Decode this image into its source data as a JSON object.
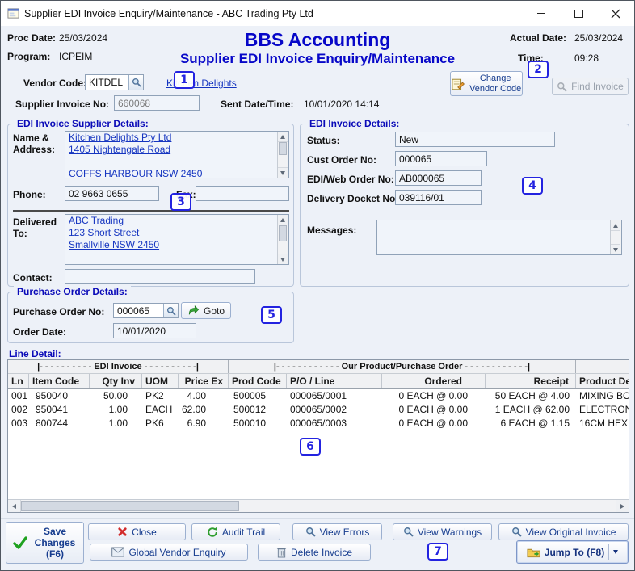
{
  "window": {
    "title": "Supplier EDI Invoice Enquiry/Maintenance - ABC Trading Pty Ltd"
  },
  "header": {
    "proc_date_label": "Proc Date:",
    "proc_date": "25/03/2024",
    "program_label": "Program:",
    "program": "ICPEIM",
    "app_title": "BBS Accounting",
    "screen_title": "Supplier EDI Invoice Enquiry/Maintenance",
    "actual_date_label": "Actual Date:",
    "actual_date": "25/03/2024",
    "time_label": "Time:",
    "time": "09:28"
  },
  "vendor": {
    "label": "Vendor Code:",
    "code": "KITDEL",
    "name_link": "Kitchen Delights",
    "change_button": "Change Vendor Code",
    "find_button": "Find Invoice"
  },
  "invoice": {
    "supplier_invoice_label": "Supplier Invoice No:",
    "supplier_invoice_no": "660068",
    "sent_label": "Sent Date/Time:",
    "sent_datetime": "10/01/2020 14:14"
  },
  "supplier_details": {
    "group_title": "EDI Invoice Supplier Details:",
    "name_address_label": "Name & Address:",
    "address_lines": [
      "Kitchen Delights Pty Ltd",
      "1405 Nightengale Road",
      "",
      "COFFS HARBOUR NSW 2450"
    ],
    "phone_label": "Phone:",
    "phone": "02 9663 0655",
    "fax_label": "Fax:",
    "fax": "",
    "delivered_label": "Delivered To:",
    "delivered_lines": [
      "ABC Trading",
      "123 Short Street",
      "Smallville NSW 2450"
    ],
    "contact_label": "Contact:",
    "contact": ""
  },
  "invoice_details": {
    "group_title": "EDI Invoice Details:",
    "status_label": "Status:",
    "status": "New",
    "cust_order_label": "Cust Order No:",
    "cust_order_no": "000065",
    "edi_web_order_label": "EDI/Web Order No:",
    "edi_web_order_no": "AB000065",
    "delivery_docket_label": "Delivery Docket No:",
    "delivery_docket_no": "039116/01",
    "messages_label": "Messages:",
    "messages": ""
  },
  "purchase_order": {
    "group_title": "Purchase Order Details:",
    "po_label": "Purchase Order No:",
    "po_no": "000065",
    "goto_button": "Goto",
    "order_date_label": "Order Date:",
    "order_date": "10/01/2020"
  },
  "line_detail": {
    "section_label": "Line Detail:",
    "band_edi": "|- - - - - - - - - -  EDI Invoice  - - - - - - - - - -|",
    "band_our": "|- - - - - - - - - - - -  Our Product/Purchase Order  - - - - - - - - - - - -|",
    "columns": [
      "Ln",
      "Item Code",
      "Qty Inv",
      "UOM",
      "Price Ex",
      "Prod Code",
      "P/O / Line",
      "Ordered",
      "Receipt",
      "Product De"
    ],
    "rows": [
      [
        "001",
        "950040",
        "50.00",
        "PK2",
        "4.00",
        "500005",
        "000065/0001",
        "0 EACH @ 0.00",
        "50 EACH @ 4.00",
        "MIXING BO"
      ],
      [
        "002",
        "950041",
        "1.00",
        "EACH",
        "62.00",
        "500012",
        "000065/0002",
        "0 EACH @ 0.00",
        "1 EACH @ 62.00",
        "ELECTRON"
      ],
      [
        "003",
        "800744",
        "1.00",
        "PK6",
        "6.90",
        "500010",
        "000065/0003",
        "0 EACH @ 0.00",
        "6 EACH @ 1.15",
        "16CM HEX"
      ]
    ]
  },
  "actions": {
    "save": "Save Changes (F6)",
    "close": "Close",
    "audit_trail": "Audit Trail",
    "view_errors": "View Errors",
    "view_warnings": "View Warnings",
    "view_original": "View Original Invoice",
    "global_vendor_enquiry": "Global Vendor Enquiry",
    "delete_invoice": "Delete Invoice",
    "jump_to": "Jump To (F8)"
  },
  "annotations": [
    "1",
    "2",
    "3",
    "4",
    "5",
    "6",
    "7"
  ],
  "icons": {
    "vendor_lookup": "magnifier-icon",
    "change_vendor": "edit-form-icon",
    "find_invoice": "magnifier-icon",
    "po_lookup": "magnifier-icon",
    "goto": "green-jump-arrow-icon",
    "save": "green-check-icon",
    "close": "red-x-icon",
    "audit_trail": "green-refresh-icon",
    "views": "magnifier-icon",
    "global_vendor_enquiry": "envelope-icon",
    "delete_invoice": "trash-icon",
    "jump_to": "folder-icon"
  },
  "colors": {
    "heading_blue": "#0707c8",
    "group_title_blue": "#0a0ab8",
    "link_blue": "#1535c0",
    "button_text_blue": "#173d8f",
    "annotation_blue": "#2323e0",
    "window_bg": "#edf1f8"
  }
}
